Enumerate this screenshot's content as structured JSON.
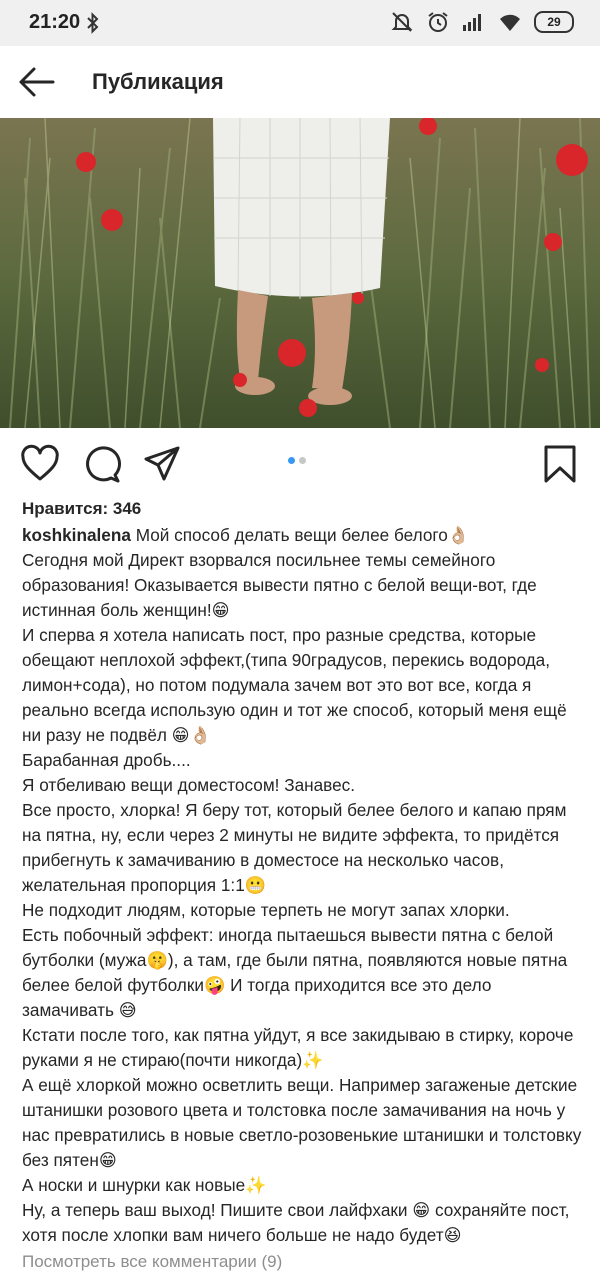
{
  "status_bar": {
    "time": "21:20",
    "battery": "29"
  },
  "header": {
    "title": "Публикация"
  },
  "carousel": {
    "count": 2,
    "active": 1
  },
  "likes": {
    "text": "Нравится: 346"
  },
  "caption": {
    "username": "koshkinalena",
    "first_line": "Мой способ делать вещи белее белого👌🏼",
    "lines": [
      "Сегодня мой Директ взорвался посильнее темы семейного образования! Оказывается вывести пятно с белой вещи-вот, где истинная боль женщин!😁",
      "И сперва я хотела написать пост, про разные средства, которые обещают неплохой эффект,(типа 90градусов, перекись водорода, лимон+сода), но потом подумала зачем вот это вот все, когда я реально всегда использую один и тот же способ, который меня ещё ни разу не подвёл 😁👌🏼",
      "Барабанная дробь....",
      "Я отбеливаю вещи доместосом! Занавес.",
      "Все просто, хлорка! Я беру тот, который белее белого и капаю прям на пятна, ну, если через 2 минуты не видите эффекта, то придётся прибегнуть к замачиванию в доместосе на несколько часов, желательная пропорция 1:1😬",
      "Не подходит людям, которые терпеть не могут запах хлорки.",
      "Есть побочный эффект: иногда пытаешься вывести пятна с белой бутболки (мужа🤫), а там, где были пятна, появляются новые пятна белее белой футболки🤪 И тогда приходится все это дело замачивать 😅",
      "Кстати после того, как пятна уйдут, я все закидываю в стирку, короче руками я не стираю(почти никогда)✨",
      "А ещё хлоркой можно осветлить вещи. Например загаженые детские штанишки розового цвета и толстовка после замачивания на ночь у нас превратились в новые светло-розовенькие штанишки и толстовку без пятен😁",
      "А носки и шнурки как новые✨",
      "Ну, а теперь ваш выход! Пишите свои лайфхаки 😁 сохраняйте пост, хотя после хлопки вам ничего больше не надо будет😆"
    ]
  },
  "comments": {
    "view_all": "Посмотреть все комментарии (9)"
  },
  "colors": {
    "accent_dot": "#3897f0",
    "inactive_dot": "#c7c7c7",
    "muted": "#8e8e8e"
  }
}
